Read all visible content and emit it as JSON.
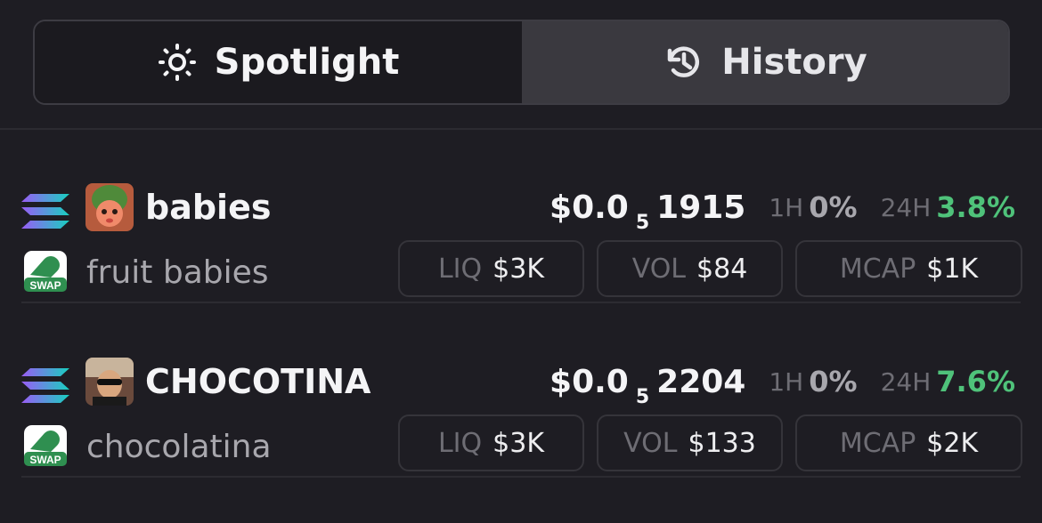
{
  "tabs": [
    {
      "label": "Spotlight",
      "icon": "sun-icon",
      "active": true
    },
    {
      "label": "History",
      "icon": "history-icon",
      "active": false
    }
  ],
  "labels": {
    "h1": "1H",
    "h24": "24H",
    "liq": "LIQ",
    "vol": "VOL",
    "mcap": "MCAP"
  },
  "colors": {
    "background": "#1e1d23",
    "positive": "#4fc27a",
    "muted": "#6e6d74"
  },
  "tokens": [
    {
      "symbol": "babies",
      "name": "fruit babies",
      "chain_icon": "solana-icon",
      "dex_icon": "swap-icon",
      "dex_label": "SWAP",
      "price_prefix": "$0.0",
      "price_zeros": "5",
      "price_digits": "1915",
      "change_1h": "0%",
      "change_24h": "3.8%",
      "liq": "$3K",
      "vol": "$84",
      "mcap": "$1K"
    },
    {
      "symbol": "CHOCOTINA",
      "name": "chocolatina",
      "chain_icon": "solana-icon",
      "dex_icon": "swap-icon",
      "dex_label": "SWAP",
      "price_prefix": "$0.0",
      "price_zeros": "5",
      "price_digits": "2204",
      "change_1h": "0%",
      "change_24h": "7.6%",
      "liq": "$3K",
      "vol": "$133",
      "mcap": "$2K"
    }
  ]
}
